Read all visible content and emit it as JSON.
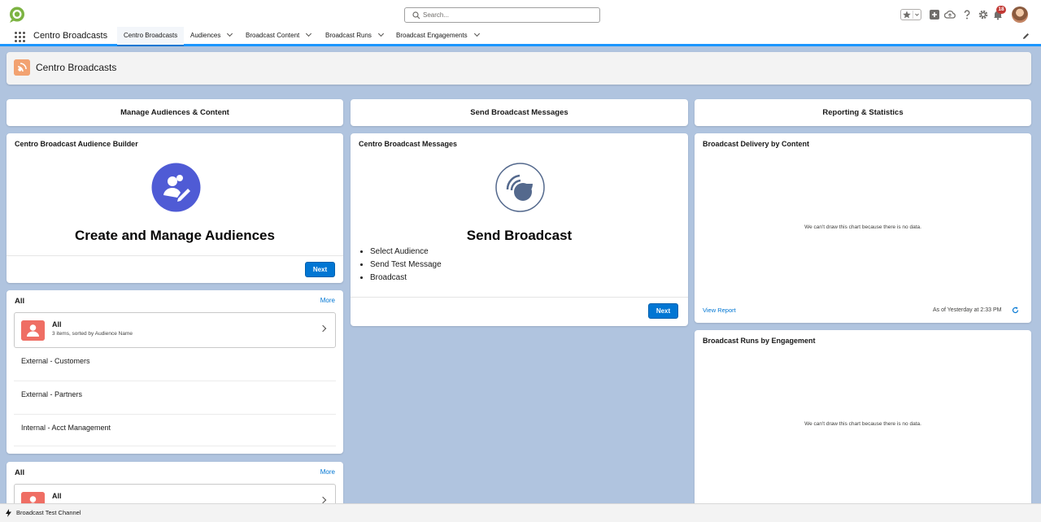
{
  "header": {
    "search_placeholder": "Search...",
    "notification_count": "18"
  },
  "nav": {
    "app_name": "Centro Broadcasts",
    "tabs": [
      {
        "label": "Centro Broadcasts",
        "active": true
      },
      {
        "label": "Audiences"
      },
      {
        "label": "Broadcast Content"
      },
      {
        "label": "Broadcast Runs"
      },
      {
        "label": "Broadcast Engagements"
      }
    ]
  },
  "page": {
    "title": "Centro Broadcasts"
  },
  "columns": {
    "left": "Manage Audiences & Content",
    "middle": "Send Broadcast Messages",
    "right": "Reporting & Statistics"
  },
  "audience_builder": {
    "title": "Centro Broadcast Audience Builder",
    "heading": "Create and Manage Audiences",
    "next_label": "Next"
  },
  "messages": {
    "title": "Centro Broadcast Messages",
    "heading": "Send Broadcast",
    "steps": [
      "Select Audience",
      "Send Test Message",
      "Broadcast"
    ],
    "next_label": "Next"
  },
  "list_view_1": {
    "title": "All",
    "more_label": "More",
    "summary_name": "All",
    "summary_sub": "3 items, sorted by Audience Name",
    "rows": [
      "External - Customers",
      "External - Partners",
      "Internal - Acct Management"
    ]
  },
  "list_view_2": {
    "title": "All",
    "more_label": "More",
    "summary_name": "All"
  },
  "report_1": {
    "title": "Broadcast Delivery by Content",
    "no_data": "We can't draw this chart because there is no data.",
    "view_report": "View Report",
    "as_of": "As of Yesterday at 2:33 PM"
  },
  "report_2": {
    "title": "Broadcast Runs by Engagement",
    "no_data": "We can't draw this chart because there is no data."
  },
  "footer": {
    "utility_label": "Broadcast Test Channel"
  },
  "colors": {
    "brand": "#0176d3",
    "background": "#b0c4df",
    "audience_icon": "#4f5bd5",
    "list_icon": "#ef6e64",
    "page_icon": "#f2a271"
  },
  "icons": [
    "app-logo-icon",
    "search-icon",
    "favorites-star-icon",
    "add-icon",
    "cloud-icon",
    "help-icon",
    "gear-icon",
    "bell-icon",
    "app-launcher-icon",
    "edit-pencil-icon",
    "broadcast-icon",
    "audience-builder-icon",
    "refresh-icon",
    "lightning-icon"
  ]
}
